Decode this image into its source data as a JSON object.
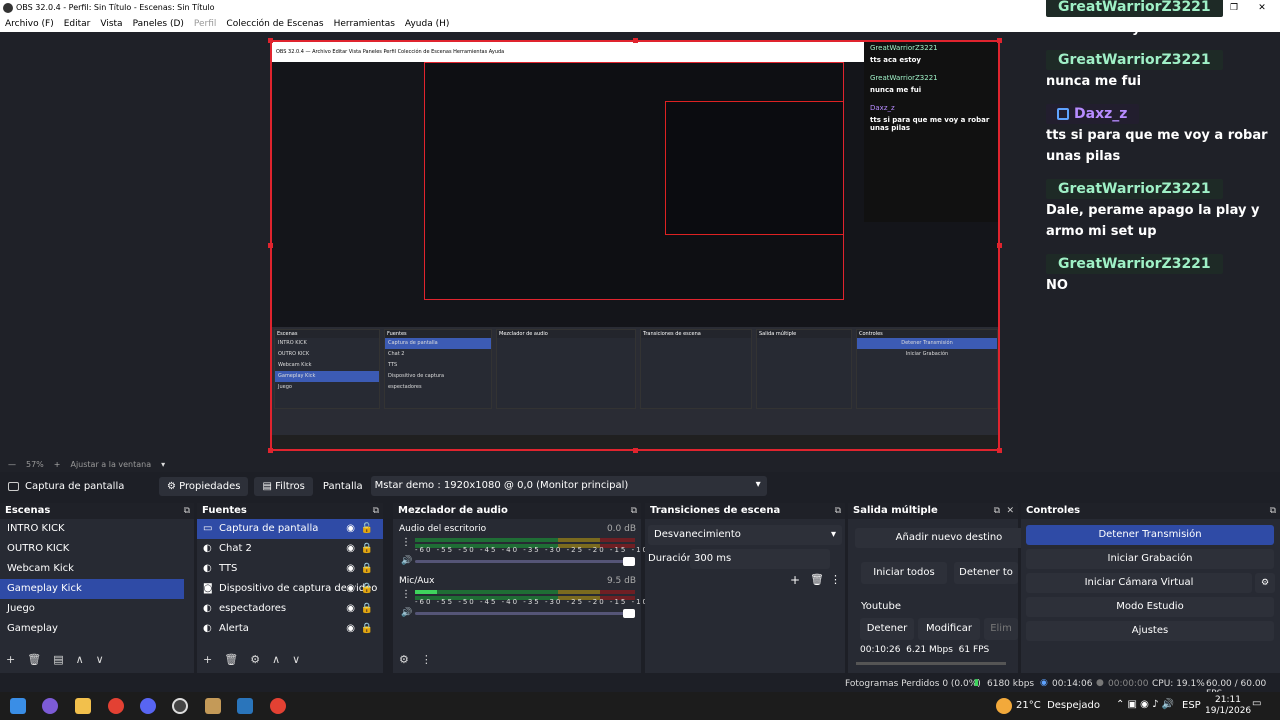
{
  "window": {
    "title": "OBS 32.0.4 - Perfil: Sin Título - Escenas: Sin Título"
  },
  "menu": {
    "items": [
      "Archivo (F)",
      "Editar",
      "Vista",
      "Paneles (D)",
      "Perfil",
      "Colección de Escenas",
      "Herramientas",
      "Ayuda (H)"
    ]
  },
  "chat": [
    {
      "user": "GreatWarriorZ3221",
      "msg": "tts aca estoy"
    },
    {
      "user": "GreatWarriorZ3221",
      "msg": "nunca me fui"
    },
    {
      "user": "Daxz_z",
      "msg": "tts si para que me voy a robar unas pilas"
    },
    {
      "user": "GreatWarriorZ3221",
      "msg": "Dale, perame apago la play y armo mi set up"
    },
    {
      "user": "GreatWarriorZ3221",
      "msg": "NO"
    }
  ],
  "zoom": {
    "level": "57%",
    "fit": "Ajustar a la ventana"
  },
  "source_bar": {
    "source": "Captura de pantalla",
    "props": "Propiedades",
    "filters": "Filtros",
    "label": "Pantalla",
    "value": "Mstar demo : 1920x1080 @ 0,0 (Monitor principal)"
  },
  "scenes": {
    "title": "Escenas",
    "items": [
      "INTRO KICK",
      "OUTRO KICK",
      "Webcam Kick",
      "Gameplay Kick",
      "Juego",
      "Gameplay"
    ],
    "selected": 3
  },
  "sources": {
    "title": "Fuentes",
    "items": [
      "Captura de pantalla",
      "Chat 2",
      "TTS",
      "Dispositivo de captura de video",
      "espectadores",
      "Alerta"
    ]
  },
  "mixer": {
    "title": "Mezclador de audio",
    "ch1_name": "Audio del escritorio",
    "ch1_db": "0.0 dB",
    "ch2_name": "Mic/Aux",
    "ch2_db": "9.5 dB",
    "scale": "-60 -55 -50 -45 -40 -35 -30 -25 -20 -15 -10 -5 0",
    "ch1_level": 0.0,
    "ch2_level": 0.1
  },
  "transitions": {
    "title": "Transiciones de escena",
    "selected": "Desvanecimiento",
    "duration_label": "Duración",
    "duration": "300 ms"
  },
  "multi": {
    "title": "Salida múltiple",
    "add": "Añadir nuevo destino",
    "start_all": "Iniciar todos",
    "stop_all": "Detener to",
    "service": "Youtube",
    "stop": "Detener",
    "modify": "Modificar",
    "delete": "Elim",
    "stats": "00:10:26  6.21 Mbps  61 FPS"
  },
  "controls": {
    "title": "Controles",
    "stop_stream": "Detener Transmisión",
    "start_rec": "Iniciar Grabación",
    "virtual_cam": "Iniciar Cámara Virtual",
    "studio": "Modo Estudio",
    "settings": "Ajustes"
  },
  "status": {
    "dropped": "Fotogramas Perdidos 0 (0.0%)",
    "kbps": "6180 kbps",
    "stream_time": "00:14:06",
    "rec_time": "00:00:00",
    "cpu": "CPU: 19.1%",
    "fps": "60.00 / 60.00 FPS"
  },
  "taskbar": {
    "weather": "21°C  Despejado",
    "lang": "ESP",
    "time": "21:11",
    "date": "19/1/2026"
  },
  "colors": {
    "accent": "#2f4ba6",
    "selection_red": "#e0242e",
    "chat_user": "#9ff0c6",
    "chat_user_alt": "#b78cff"
  }
}
